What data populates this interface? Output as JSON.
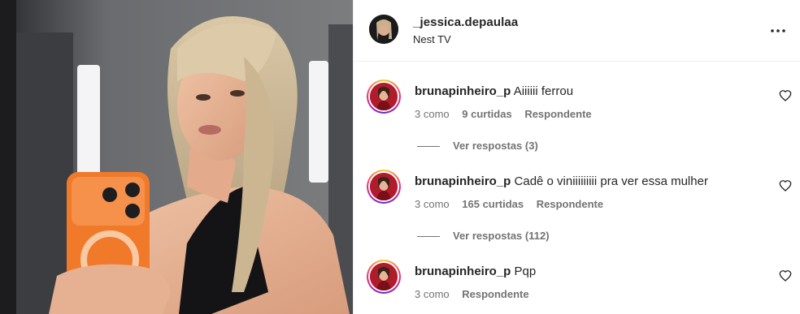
{
  "post": {
    "username": "_jessica.depaulaa",
    "subtitle": "Nest TV"
  },
  "comments": [
    {
      "username": "brunapinheiro_p",
      "text": "Aiiiiii ferrou",
      "time": "3 como",
      "likes": "9 curtidas",
      "reply": "Respondente",
      "view_replies": "Ver respostas (3)"
    },
    {
      "username": "brunapinheiro_p",
      "text": "Cadê o viniiiiiiiii pra ver essa mulher",
      "time": "3 como",
      "likes": "165 curtidas",
      "reply": "Respondente",
      "view_replies": "Ver respostas (112)"
    },
    {
      "username": "brunapinheiro_p",
      "text": "Pqp",
      "time": "3 como",
      "reply": "Respondente"
    }
  ],
  "icons": {
    "more": "more-options-icon",
    "like": "heart-icon"
  },
  "colors": {
    "text": "#262626",
    "secondary": "#737373",
    "divider": "#efefef",
    "phone_case": "#f07a2a"
  }
}
